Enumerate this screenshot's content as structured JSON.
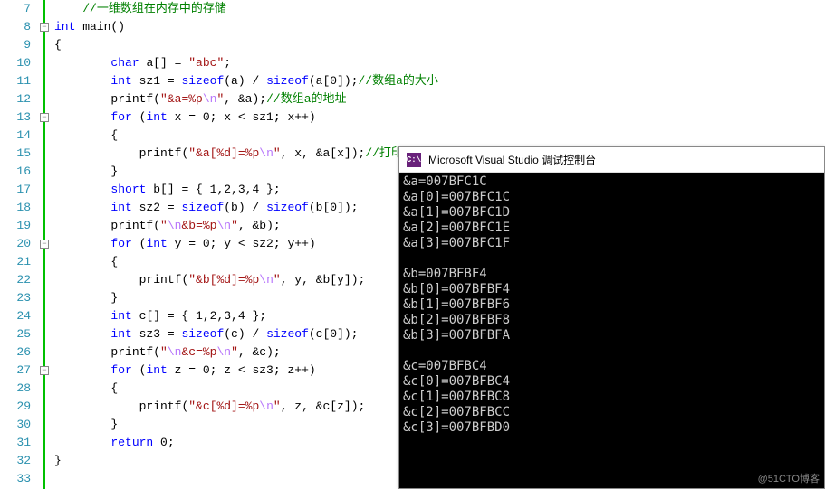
{
  "editor": {
    "first_line": 7,
    "last_line": 33,
    "fold_markers": [
      8,
      13,
      20,
      27
    ],
    "lines": {
      "7": {
        "indent": 1,
        "tokens": [
          [
            "cmt",
            "//一维数组在内存中的存储"
          ]
        ]
      },
      "8": {
        "indent": 0,
        "tokens": [
          [
            "kw",
            "int"
          ],
          [
            "op",
            " main()"
          ]
        ]
      },
      "9": {
        "indent": 0,
        "tokens": [
          [
            "op",
            "{"
          ]
        ]
      },
      "10": {
        "indent": 2,
        "tokens": [
          [
            "kw",
            "char"
          ],
          [
            "op",
            " a[] = "
          ],
          [
            "str",
            "\"abc\""
          ],
          [
            "op",
            ";"
          ]
        ]
      },
      "11": {
        "indent": 2,
        "tokens": [
          [
            "kw",
            "int"
          ],
          [
            "op",
            " sz1 = "
          ],
          [
            "kw",
            "sizeof"
          ],
          [
            "op",
            "(a) / "
          ],
          [
            "kw",
            "sizeof"
          ],
          [
            "op",
            "(a[0]);"
          ],
          [
            "cmt",
            "//数组a的大小"
          ]
        ]
      },
      "12": {
        "indent": 2,
        "tokens": [
          [
            "fn",
            "printf"
          ],
          [
            "op",
            "("
          ],
          [
            "str",
            "\"&a=%p"
          ],
          [
            "esc",
            "\\n"
          ],
          [
            "str",
            "\""
          ],
          [
            "op",
            ", &a);"
          ],
          [
            "cmt",
            "//数组a的地址"
          ]
        ]
      },
      "13": {
        "indent": 2,
        "tokens": [
          [
            "kw",
            "for"
          ],
          [
            "op",
            " ("
          ],
          [
            "kw",
            "int"
          ],
          [
            "op",
            " x = 0; x < sz1; x++)"
          ]
        ]
      },
      "14": {
        "indent": 2,
        "tokens": [
          [
            "op",
            "{"
          ]
        ]
      },
      "15": {
        "indent": 3,
        "tokens": [
          [
            "fn",
            "printf"
          ],
          [
            "op",
            "("
          ],
          [
            "str",
            "\"&a[%d]=%p"
          ],
          [
            "esc",
            "\\n"
          ],
          [
            "str",
            "\""
          ],
          [
            "op",
            ", x, &a[x]);"
          ],
          [
            "cmt",
            "//打印数组a各元素的地址"
          ]
        ]
      },
      "16": {
        "indent": 2,
        "tokens": [
          [
            "op",
            "}"
          ]
        ]
      },
      "17": {
        "indent": 2,
        "tokens": [
          [
            "kw",
            "short"
          ],
          [
            "op",
            " b[] = { 1,2,3,4 };"
          ]
        ]
      },
      "18": {
        "indent": 2,
        "tokens": [
          [
            "kw",
            "int"
          ],
          [
            "op",
            " sz2 = "
          ],
          [
            "kw",
            "sizeof"
          ],
          [
            "op",
            "(b) / "
          ],
          [
            "kw",
            "sizeof"
          ],
          [
            "op",
            "(b[0]);"
          ]
        ]
      },
      "19": {
        "indent": 2,
        "tokens": [
          [
            "fn",
            "printf"
          ],
          [
            "op",
            "("
          ],
          [
            "str",
            "\""
          ],
          [
            "esc",
            "\\n"
          ],
          [
            "str",
            "&b=%p"
          ],
          [
            "esc",
            "\\n"
          ],
          [
            "str",
            "\""
          ],
          [
            "op",
            ", &b);"
          ]
        ]
      },
      "20": {
        "indent": 2,
        "tokens": [
          [
            "kw",
            "for"
          ],
          [
            "op",
            " ("
          ],
          [
            "kw",
            "int"
          ],
          [
            "op",
            " y = 0; y < sz2; y++)"
          ]
        ]
      },
      "21": {
        "indent": 2,
        "tokens": [
          [
            "op",
            "{"
          ]
        ]
      },
      "22": {
        "indent": 3,
        "tokens": [
          [
            "fn",
            "printf"
          ],
          [
            "op",
            "("
          ],
          [
            "str",
            "\"&b[%d]=%p"
          ],
          [
            "esc",
            "\\n"
          ],
          [
            "str",
            "\""
          ],
          [
            "op",
            ", y, &b[y]);"
          ]
        ]
      },
      "23": {
        "indent": 2,
        "tokens": [
          [
            "op",
            "}"
          ]
        ]
      },
      "24": {
        "indent": 2,
        "tokens": [
          [
            "kw",
            "int"
          ],
          [
            "op",
            " c[] = { 1,2,3,4 };"
          ]
        ]
      },
      "25": {
        "indent": 2,
        "tokens": [
          [
            "kw",
            "int"
          ],
          [
            "op",
            " sz3 = "
          ],
          [
            "kw",
            "sizeof"
          ],
          [
            "op",
            "(c) / "
          ],
          [
            "kw",
            "sizeof"
          ],
          [
            "op",
            "(c[0]);"
          ]
        ]
      },
      "26": {
        "indent": 2,
        "tokens": [
          [
            "fn",
            "printf"
          ],
          [
            "op",
            "("
          ],
          [
            "str",
            "\""
          ],
          [
            "esc",
            "\\n"
          ],
          [
            "str",
            "&c=%p"
          ],
          [
            "esc",
            "\\n"
          ],
          [
            "str",
            "\""
          ],
          [
            "op",
            ", &c);"
          ]
        ]
      },
      "27": {
        "indent": 2,
        "tokens": [
          [
            "kw",
            "for"
          ],
          [
            "op",
            " ("
          ],
          [
            "kw",
            "int"
          ],
          [
            "op",
            " z = 0; z < sz3; z++)"
          ]
        ]
      },
      "28": {
        "indent": 2,
        "tokens": [
          [
            "op",
            "{"
          ]
        ]
      },
      "29": {
        "indent": 3,
        "tokens": [
          [
            "fn",
            "printf"
          ],
          [
            "op",
            "("
          ],
          [
            "str",
            "\"&c[%d]=%p"
          ],
          [
            "esc",
            "\\n"
          ],
          [
            "str",
            "\""
          ],
          [
            "op",
            ", z, &c[z]);"
          ]
        ]
      },
      "30": {
        "indent": 2,
        "tokens": [
          [
            "op",
            "}"
          ]
        ]
      },
      "31": {
        "indent": 2,
        "tokens": [
          [
            "kw",
            "return"
          ],
          [
            "op",
            " 0;"
          ]
        ]
      },
      "32": {
        "indent": 0,
        "tokens": [
          [
            "op",
            "}"
          ]
        ]
      },
      "33": {
        "indent": 0,
        "tokens": []
      }
    }
  },
  "console": {
    "icon_text": "C:\\",
    "title": "Microsoft Visual Studio 调试控制台",
    "lines": [
      "&a=007BFC1C",
      "&a[0]=007BFC1C",
      "&a[1]=007BFC1D",
      "&a[2]=007BFC1E",
      "&a[3]=007BFC1F",
      "",
      "&b=007BFBF4",
      "&b[0]=007BFBF4",
      "&b[1]=007BFBF6",
      "&b[2]=007BFBF8",
      "&b[3]=007BFBFA",
      "",
      "&c=007BFBC4",
      "&c[0]=007BFBC4",
      "&c[1]=007BFBC8",
      "&c[2]=007BFBCC",
      "&c[3]=007BFBD0"
    ]
  },
  "watermark": "@51CTO博客"
}
